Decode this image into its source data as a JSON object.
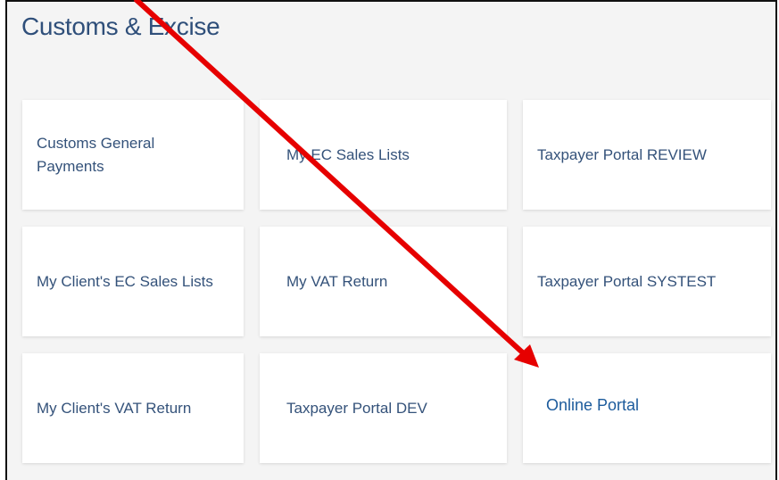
{
  "section": {
    "title": "Customs & Excise"
  },
  "cards": [
    {
      "label": "Customs General Payments"
    },
    {
      "label": "My EC Sales Lists"
    },
    {
      "label": "Taxpayer Portal REVIEW"
    },
    {
      "label": "My Client's EC Sales Lists"
    },
    {
      "label": "My VAT Return"
    },
    {
      "label": "Taxpayer Portal SYSTEST"
    },
    {
      "label": "My Client's VAT Return"
    },
    {
      "label": "Taxpayer Portal DEV"
    },
    {
      "label": "Online Portal"
    }
  ],
  "annotation": {
    "arrow_color": "#e60000"
  },
  "colors": {
    "title": "#2f4f7a",
    "card_text": "#34527a",
    "link_text": "#1c5b9c",
    "panel_bg": "#f4f4f4"
  }
}
